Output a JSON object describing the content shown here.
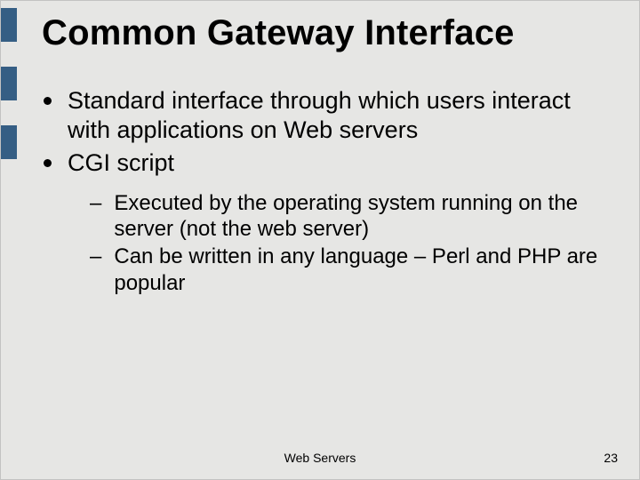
{
  "title": "Common Gateway Interface",
  "bullets": {
    "b1": "Standard interface through which users interact with applications on Web servers",
    "b2": "CGI script",
    "b2_sub": {
      "s1": "Executed by the operating system running on the server (not the web server)",
      "s2": "Can be written in any language – Perl and PHP are popular"
    }
  },
  "footer": {
    "center": "Web Servers",
    "page": "23"
  }
}
